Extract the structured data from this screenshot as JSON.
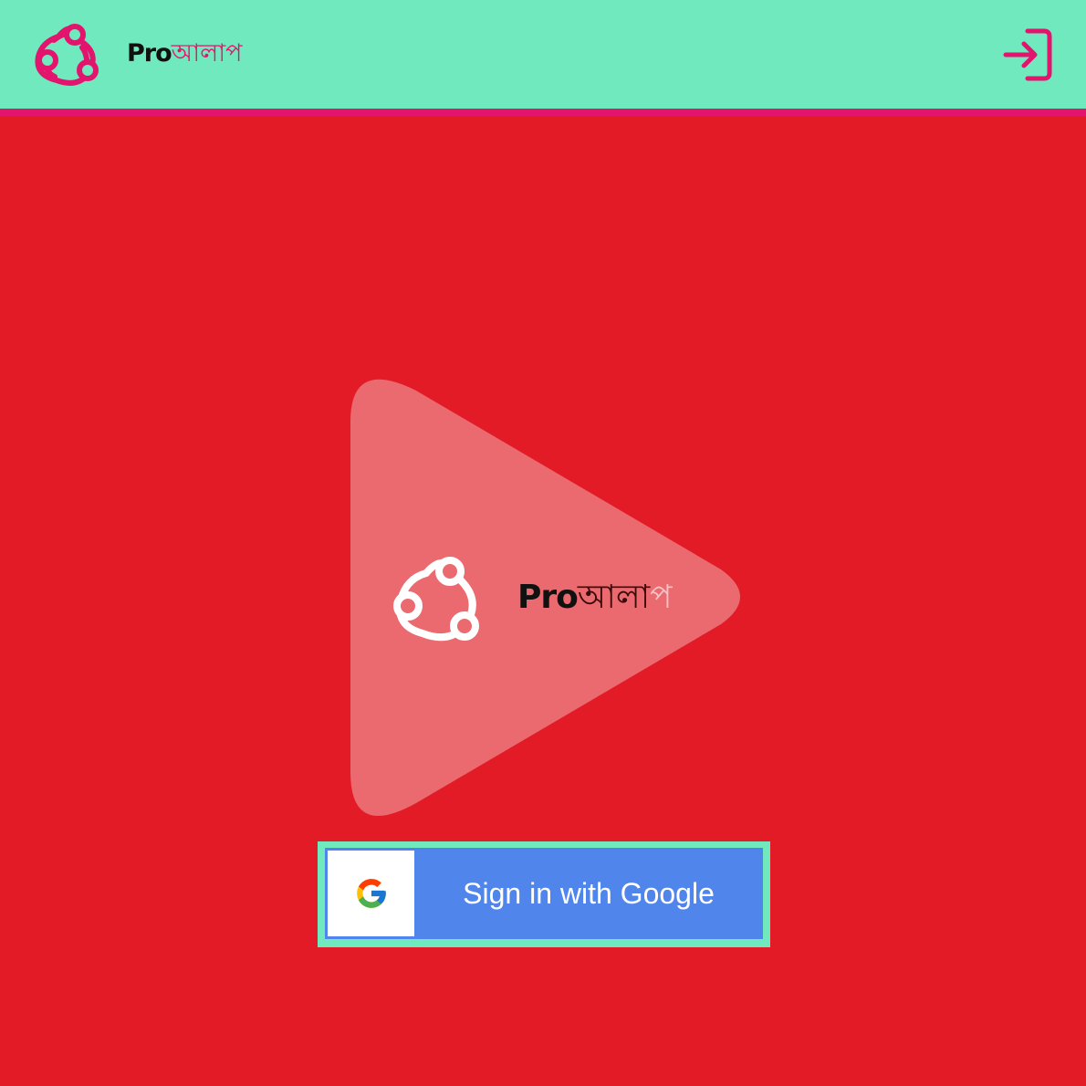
{
  "header": {
    "brand_latin": "Pro",
    "brand_bengali": "আলাপ",
    "logo_icon": "network-nodes-icon",
    "login_icon": "login-arrow-icon"
  },
  "hero": {
    "shape": "play-triangle",
    "brand_latin": "Pro",
    "brand_bengali_main": "আলা",
    "brand_bengali_fade": "প",
    "logo_icon": "network-nodes-icon"
  },
  "signin": {
    "label": "Sign in with Google",
    "icon": "google-g-icon"
  },
  "colors": {
    "background": "#e31b26",
    "header": "#6fe9bd",
    "accent": "#e3146d",
    "google_blue": "#5086ec",
    "hero_shape": "#ea6a6f"
  }
}
